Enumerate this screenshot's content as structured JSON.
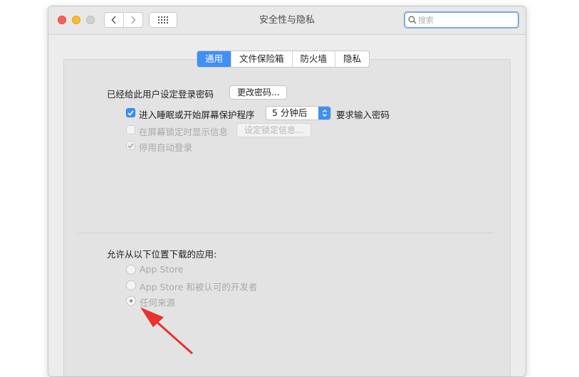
{
  "window": {
    "title": "安全性与隐私"
  },
  "toolbar": {
    "back_icon": "chevron-left-icon",
    "forward_icon": "chevron-right-icon",
    "grid_icon": "grid-icon"
  },
  "search": {
    "placeholder": "搜索",
    "value": ""
  },
  "tabs": [
    {
      "label": "通用",
      "active": true
    },
    {
      "label": "文件保险箱",
      "active": false
    },
    {
      "label": "防火墙",
      "active": false
    },
    {
      "label": "隐私",
      "active": false
    }
  ],
  "general": {
    "password_set_label": "已经给此用户设定登录密码",
    "change_password_button": "更改密码...",
    "require_password": {
      "checked": true,
      "label": "进入睡眠或开始屏幕保护程序",
      "delay_value": "5 分钟后",
      "suffix": "要求输入密码"
    },
    "lock_message": {
      "checked": false,
      "enabled": false,
      "label": "在屏幕锁定时显示信息",
      "button": "设定锁定信息..."
    },
    "disable_auto_login": {
      "checked": true,
      "enabled": false,
      "label": "停用自动登录"
    }
  },
  "downloads": {
    "heading": "允许从以下位置下载的应用:",
    "options": [
      {
        "label": "App Store",
        "selected": false
      },
      {
        "label": "App Store 和被认可的开发者",
        "selected": false
      },
      {
        "label": "任何来源",
        "selected": true
      }
    ]
  },
  "colors": {
    "accent": "#3f8ff5",
    "annotation_arrow": "#e8322d"
  }
}
